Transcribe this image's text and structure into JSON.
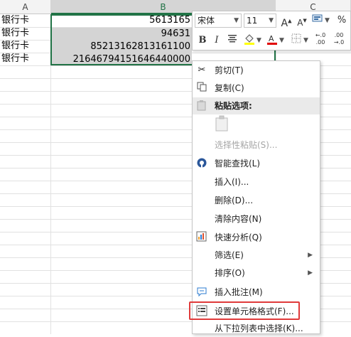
{
  "columns": {
    "a": "A",
    "b": "B",
    "c": "C"
  },
  "rows": [
    {
      "a": "银行卡",
      "b": "5613165"
    },
    {
      "a": "银行卡",
      "b": "94631"
    },
    {
      "a": "银行卡",
      "b": "85213162813161100"
    },
    {
      "a": "银行卡",
      "b": "21646794151646440000"
    }
  ],
  "mini_toolbar": {
    "font_name": "宋体",
    "font_size": "11",
    "percent": "%",
    "increase_decimal": "←.0\n.00",
    "decrease_decimal": ".00\n→.0"
  },
  "context_menu": {
    "items": [
      {
        "label": "剪切(T)"
      },
      {
        "label": "复制(C)"
      },
      {
        "label": "粘贴选项:"
      },
      {
        "label": "选择性粘贴(S)..."
      },
      {
        "label": "智能查找(L)"
      },
      {
        "label": "插入(I)..."
      },
      {
        "label": "删除(D)..."
      },
      {
        "label": "清除内容(N)"
      },
      {
        "label": "快速分析(Q)"
      },
      {
        "label": "筛选(E)"
      },
      {
        "label": "排序(O)"
      },
      {
        "label": "插入批注(M)"
      },
      {
        "label": "设置单元格格式(F)..."
      },
      {
        "label": "从下拉列表中选择(K)..."
      }
    ]
  },
  "colors": {
    "excel_green": "#217346",
    "highlight_red": "#e03a3a",
    "selection_gray": "#d4d4d4"
  }
}
